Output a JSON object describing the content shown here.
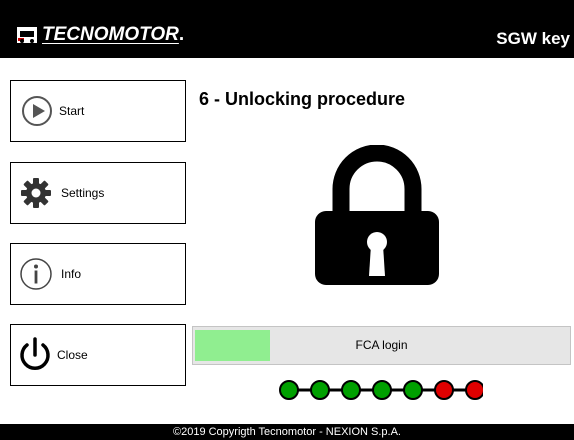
{
  "header": {
    "brand": "TECNOMOTOR",
    "title": "SGW key"
  },
  "nav": [
    {
      "label": "Start",
      "icon": "play-icon"
    },
    {
      "label": "Settings",
      "icon": "gear-icon"
    },
    {
      "label": "Info",
      "icon": "info-icon"
    },
    {
      "label": "Close",
      "icon": "power-icon"
    }
  ],
  "main": {
    "step_title": "6 - Unlocking procedure",
    "icon": "lock-icon",
    "progress": {
      "label": "FCA login",
      "value": 0.2
    },
    "steps": {
      "statuses": [
        "done",
        "done",
        "done",
        "done",
        "done",
        "error",
        "error"
      ]
    }
  },
  "footer": {
    "text": "©2019 Copyrigth Tecnomotor - NEXION S.p.A."
  },
  "colors": {
    "step_done": "#00a000",
    "step_error": "#e00000",
    "progress_fill": "#90ee90"
  }
}
